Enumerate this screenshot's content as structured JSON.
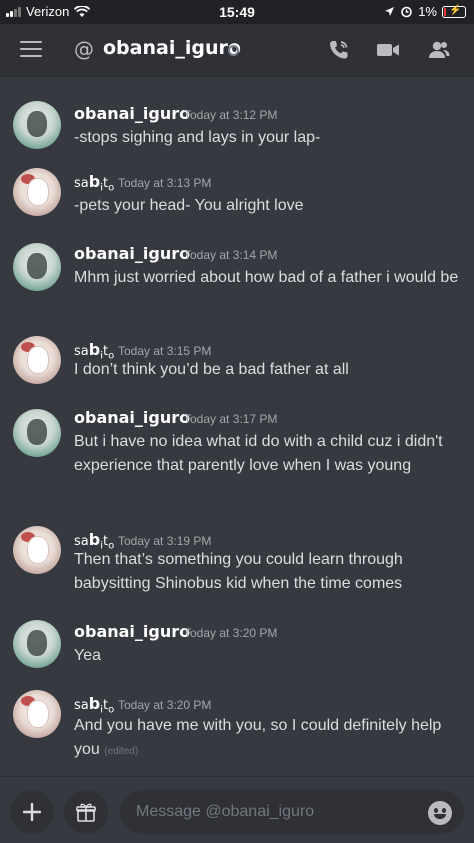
{
  "status_bar": {
    "carrier": "Verizon",
    "time": "15:49",
    "battery": "1%"
  },
  "header": {
    "at_symbol": "@",
    "channel_name": "obanai_iguro",
    "icons": [
      "menu-icon",
      "call-icon",
      "video-icon",
      "members-icon"
    ]
  },
  "messages": [
    {
      "author": "obanai_iguro",
      "author_style": "plain",
      "timestamp": "Today at 3:12 PM",
      "content": "-stops sighing and lays in your lap-",
      "avatar": "obanai"
    },
    {
      "author_parts": [
        "sa",
        "b",
        "i",
        "t",
        "o"
      ],
      "author_style": "fancy",
      "timestamp": "Today at 3:13 PM",
      "content": "-pets your head- You alright love",
      "avatar": "sabito"
    },
    {
      "author": "obanai_iguro",
      "author_style": "plain",
      "timestamp": "Today at 3:14 PM",
      "content": "Mhm just worried about how bad of a father i would be",
      "avatar": "obanai"
    },
    {
      "author_parts": [
        "sa",
        "b",
        "i",
        "t",
        "o"
      ],
      "author_style": "fancy",
      "timestamp": "Today at 3:15 PM",
      "content": "I don’t think you’d be a bad father at all",
      "avatar": "sabito"
    },
    {
      "author": "obanai_iguro",
      "author_style": "plain",
      "timestamp": "Today at 3:17 PM",
      "content": "But i have no idea what id do with a child cuz i didn't experience that parently love when I was young",
      "avatar": "obanai"
    },
    {
      "author_parts": [
        "sa",
        "b",
        "i",
        "t",
        "o"
      ],
      "author_style": "fancy",
      "timestamp": "Today at 3:19 PM",
      "content": "Then that’s something you could learn through babysitting Shinobus kid when the time comes",
      "avatar": "sabito"
    },
    {
      "author": "obanai_iguro",
      "author_style": "plain",
      "timestamp": "Today at 3:20 PM",
      "content": "Yea",
      "avatar": "obanai"
    },
    {
      "author_parts": [
        "sa",
        "b",
        "i",
        "t",
        "o"
      ],
      "author_style": "fancy",
      "timestamp": "Today at 3:20 PM",
      "content": "And you have me with you, so I could definitely help you",
      "edited": "(edited)",
      "avatar": "sabito"
    }
  ],
  "composer": {
    "placeholder": "Message @obanai_iguro",
    "icons": [
      "plus-icon",
      "gift-icon",
      "emoji-icon"
    ]
  },
  "colors": {
    "background": "#36393f",
    "header": "#2f3136",
    "text": "#dcddde",
    "muted": "#a3a6aa"
  }
}
